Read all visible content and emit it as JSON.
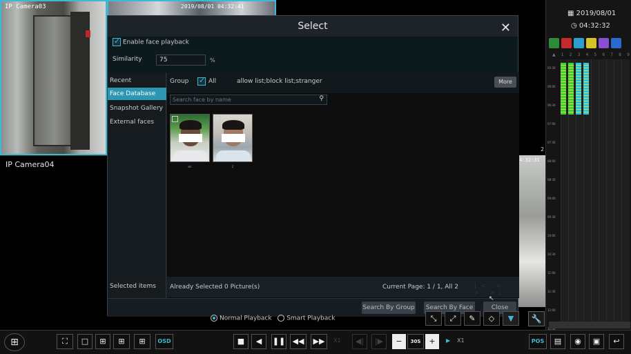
{
  "cameras": {
    "cam1_label": "IP Camera03",
    "cam_top_ts": "2019/08/01 04:32:41",
    "cam4_label": "IP Camera04",
    "cam_right_ts": "04:32:31",
    "cam_right_num": "2"
  },
  "right_panel": {
    "date": "2019/08/01",
    "time": "04:32:32",
    "channel_numbers": [
      "1",
      "2",
      "3",
      "4",
      "5",
      "6",
      "7",
      "8",
      "9"
    ],
    "time_labels": [
      "05:30",
      "06:00",
      "06:30",
      "07:00",
      "07:30",
      "08:00",
      "08:30",
      "09:00",
      "09:30",
      "10:00",
      "10:30",
      "11:00",
      "11:30",
      "12:00",
      "12:30"
    ]
  },
  "modal": {
    "title": "Select",
    "close": "✕",
    "enable_face_label": "Enable face playback",
    "similarity_label": "Similarity",
    "similarity_value": "75",
    "similarity_unit": "%",
    "side_items": [
      "Recent",
      "Face Database",
      "Snapshot Gallery",
      "External faces"
    ],
    "selected_items_label": "Selected items",
    "group_label": "Group",
    "all_label": "All",
    "list_label": "allow list;block list;stranger",
    "more_label": "More",
    "search_placeholder": "Search face by name",
    "faces": [
      {
        "name": "ac"
      },
      {
        "name": "2"
      }
    ],
    "already_selected": "Already Selected 0 Picture(s)",
    "current_page": "Current Page: 1 / 1, All 2",
    "pager": "|< < > >|",
    "btn_search_group": "Search By Group",
    "btn_search_face": "Search By Face",
    "btn_close": "Close"
  },
  "playback": {
    "normal": "Normal Playback",
    "smart": "Smart Playback"
  },
  "toolbar": {
    "osd": "OSD",
    "pos": "POS",
    "speed_step": "30S",
    "x1_a": "X1",
    "x1_b": "X1"
  },
  "colors": {
    "accent": "#3fb8d6",
    "active_side": "#2c96b4",
    "timeline_green": "#39d43a",
    "timeline_cyan": "#24c6e6",
    "timeline_yellow": "#e6d83a"
  }
}
